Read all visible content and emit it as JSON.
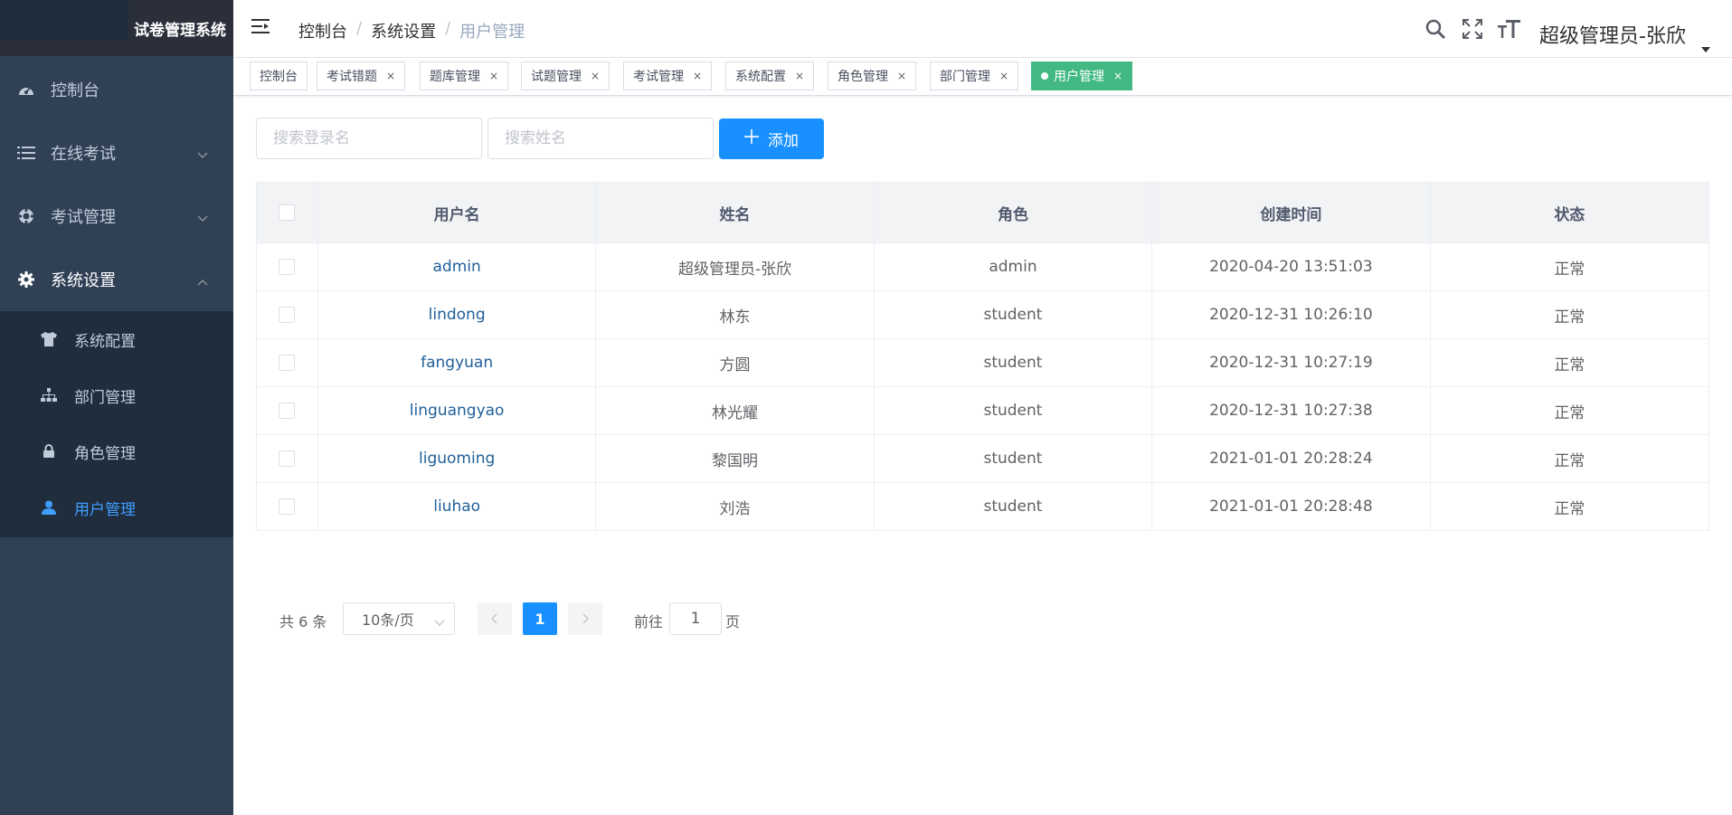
{
  "app": {
    "logo_text": "试卷管理系统"
  },
  "sidebar": {
    "items": [
      {
        "label": "控制台",
        "icon": "dashboard-icon"
      },
      {
        "label": "在线考试",
        "icon": "list-icon",
        "arrow": "chevron-down"
      },
      {
        "label": "考试管理",
        "icon": "lifebuoy-icon",
        "arrow": "chevron-down"
      },
      {
        "label": "系统设置",
        "icon": "gear-icon",
        "arrow": "chevron-up"
      }
    ],
    "subitems": [
      {
        "label": "系统配置",
        "icon": "shirt-icon"
      },
      {
        "label": "部门管理",
        "icon": "sitemap-icon"
      },
      {
        "label": "角色管理",
        "icon": "lock-icon"
      },
      {
        "label": "用户管理",
        "icon": "user-icon",
        "active": true
      }
    ],
    "colors": {
      "bg": "#304156",
      "sub_bg": "#1f2d3d",
      "text": "#bfcbd9",
      "active": "#409eff"
    }
  },
  "header": {
    "breadcrumb": [
      "控制台",
      "系统设置",
      "用户管理"
    ],
    "user_name": "超级管理员-张欣",
    "icons": [
      "search-icon",
      "fullscreen-icon",
      "font-size-icon"
    ]
  },
  "tags": [
    {
      "label": "控制台",
      "closable": false
    },
    {
      "label": "考试错题",
      "closable": true
    },
    {
      "label": "题库管理",
      "closable": true
    },
    {
      "label": "试题管理",
      "closable": true
    },
    {
      "label": "考试管理",
      "closable": true
    },
    {
      "label": "系统配置",
      "closable": true
    },
    {
      "label": "角色管理",
      "closable": true
    },
    {
      "label": "部门管理",
      "closable": true
    },
    {
      "label": "用户管理",
      "closable": true,
      "active": true
    }
  ],
  "toolbar": {
    "search_login_placeholder": "搜索登录名",
    "search_name_placeholder": "搜索姓名",
    "add_label": "添加"
  },
  "table": {
    "columns": [
      "用户名",
      "姓名",
      "角色",
      "创建时间",
      "状态"
    ],
    "rows": [
      {
        "username": "admin",
        "name": "超级管理员-张欣",
        "role": "admin",
        "created": "2020-04-20 13:51:03",
        "status": "正常"
      },
      {
        "username": "lindong",
        "name": "林东",
        "role": "student",
        "created": "2020-12-31 10:26:10",
        "status": "正常"
      },
      {
        "username": "fangyuan",
        "name": "方圆",
        "role": "student",
        "created": "2020-12-31 10:27:19",
        "status": "正常"
      },
      {
        "username": "linguangyao",
        "name": "林光耀",
        "role": "student",
        "created": "2020-12-31 10:27:38",
        "status": "正常"
      },
      {
        "username": "liguoming",
        "name": "黎国明",
        "role": "student",
        "created": "2021-01-01 20:28:24",
        "status": "正常"
      },
      {
        "username": "liuhao",
        "name": "刘浩",
        "role": "student",
        "created": "2021-01-01 20:28:48",
        "status": "正常"
      }
    ]
  },
  "pagination": {
    "total_text": "共 6 条",
    "page_size": "10条/页",
    "current_page": "1",
    "goto_prefix": "前往",
    "goto_value": "1",
    "goto_suffix": "页"
  }
}
